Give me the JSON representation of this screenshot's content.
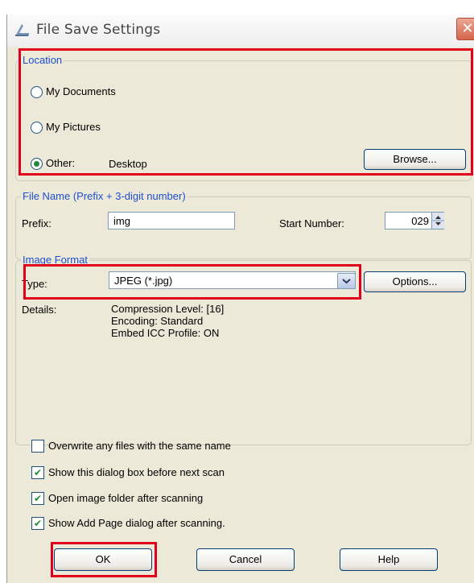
{
  "window": {
    "title": "File Save Settings",
    "close_glyph": "✕",
    "title_icon": "scanner-icon"
  },
  "location": {
    "legend": "Location",
    "options": [
      "My Documents",
      "My Pictures",
      "Other:"
    ],
    "selected": "Other:",
    "other_path": "Desktop",
    "browse_label": "Browse..."
  },
  "file_name": {
    "legend": "File Name (Prefix + 3-digit number)",
    "prefix_label": "Prefix:",
    "prefix_value": "img",
    "start_label": "Start Number:",
    "start_value": "029"
  },
  "image_format": {
    "legend": "Image Format",
    "type_label": "Type:",
    "type_value": "JPEG (*.jpg)",
    "options_label": "Options...",
    "details_label": "Details:",
    "details": [
      "Compression Level: [16]",
      "Encoding: Standard",
      "Embed ICC Profile: ON"
    ]
  },
  "checkboxes": [
    {
      "label": "Overwrite any files with the same name",
      "checked": false
    },
    {
      "label": "Show this dialog box before next scan",
      "checked": true
    },
    {
      "label": "Open image folder after scanning",
      "checked": true
    },
    {
      "label": "Show Add Page dialog after scanning.",
      "checked": true
    }
  ],
  "buttons": {
    "ok": "OK",
    "cancel": "Cancel",
    "help": "Help"
  },
  "colors": {
    "highlight": "#e0001b",
    "legend_text": "#1f4fd0",
    "dialog_bg": "#ece9d8"
  }
}
